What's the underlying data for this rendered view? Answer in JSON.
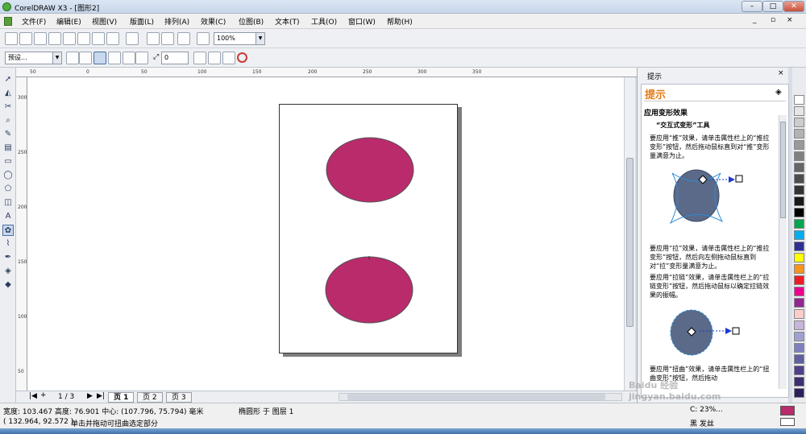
{
  "app": {
    "title": "CorelDRAW X3 - [图形2]"
  },
  "menu": [
    "文件(F)",
    "编辑(E)",
    "视图(V)",
    "版面(L)",
    "排列(A)",
    "效果(C)",
    "位图(B)",
    "文本(T)",
    "工具(O)",
    "窗口(W)",
    "帮助(H)"
  ],
  "toolbar": {
    "zoom_value": "100%"
  },
  "propbar": {
    "preset_value": "预设...",
    "amplitude_value": "0"
  },
  "rulers": {
    "h_labels": [
      "50",
      "0",
      "50",
      "100",
      "150",
      "200",
      "250",
      "300",
      "350"
    ],
    "v_labels": [
      "300",
      "250",
      "200",
      "150",
      "100",
      "50"
    ]
  },
  "pages": {
    "nav": "1 / 3",
    "tabs": [
      "页 1",
      "页 2",
      "页 3"
    ]
  },
  "docker": {
    "title": "提示",
    "header": "提示",
    "section_title": "应用变形效果",
    "tool_line": "“交互式变形”工具",
    "items": [
      "要应用“推”效果，请单击属性栏上的“推拉变形”按钮，然后拖动鼠标直到对“推”变形量满意为止。",
      "要应用“拉”效果，请单击属性栏上的“推拉变形”按钮，然后向左侧拖动鼠标直到对“拉”变形量满意为止。",
      "要应用“拉链”效果，请单击属性栏上的“拉链变形”按钮，然后拖动鼠标以确定拉链效果的振幅。",
      "要应用“扭曲”效果，请单击属性栏上的“扭曲变形”按钮，然后拖动"
    ]
  },
  "shapes": {
    "fill_color": "#b92b6b",
    "outline_color": "#555555"
  },
  "status": {
    "size": "宽度: 103.467  高度: 76.901  中心: (107.796, 75.794)  毫米",
    "object": "椭圆形 于 图层 1",
    "coords": "( 132.964, 92.572 )",
    "hint": "单击并拖动可扭曲选定部分",
    "fill_label": "黑 发丝",
    "fill_value": "C: 23%..."
  },
  "watermark": "Baidu 经验\njingyan.baidu.com",
  "palette_colors": [
    "#ffffff",
    "#e6e6e6",
    "#cccccc",
    "#b3b3b3",
    "#999999",
    "#808080",
    "#666666",
    "#4d4d4d",
    "#333333",
    "#1a1a1a",
    "#000000",
    "#00a651",
    "#00aeef",
    "#2e3192",
    "#ffff00",
    "#f7941d",
    "#ed1c24",
    "#ec008c",
    "#92278f",
    "#ffcccc",
    "#c8b5d9",
    "#a0a0d0",
    "#8080c0",
    "#6060a0",
    "#503f8a",
    "#3d2f70",
    "#2a205a"
  ]
}
